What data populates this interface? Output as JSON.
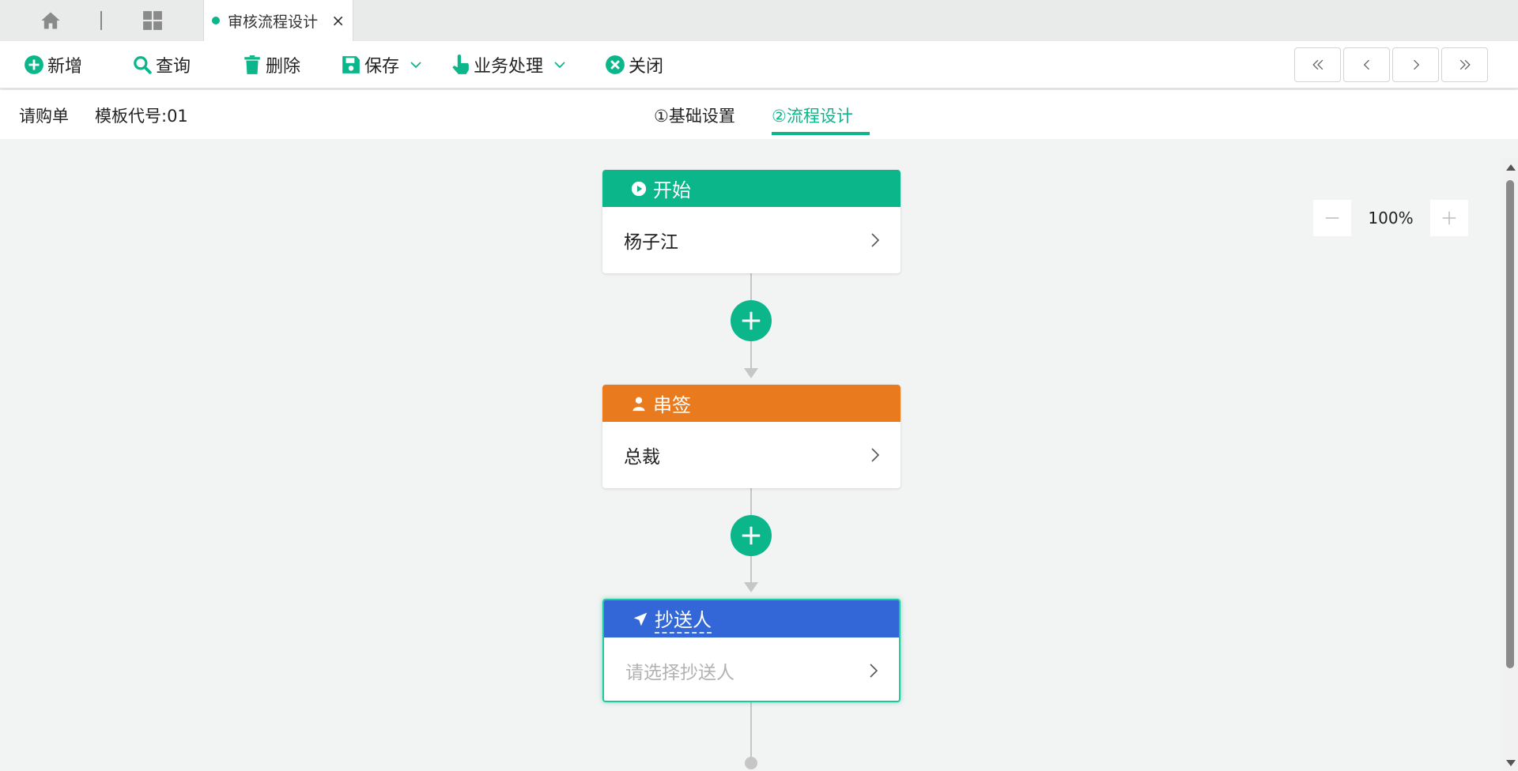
{
  "tabbar": {
    "home_icon": "home-icon",
    "apps_icon": "grid-icon",
    "active_tab": {
      "label": "审核流程设计",
      "close": "×"
    }
  },
  "toolbar": {
    "add": "新增",
    "query": "查询",
    "delete": "删除",
    "save": "保存",
    "business": "业务处理",
    "close": "关闭"
  },
  "pager": [
    "first-page-icon",
    "prev-page-icon",
    "next-page-icon",
    "last-page-icon"
  ],
  "info": {
    "doc_type": "请购单",
    "template": "模板代号:01"
  },
  "steps": {
    "step1": "①基础设置",
    "step2": "②流程设计"
  },
  "zoom": {
    "value": "100%"
  },
  "flow": {
    "start": {
      "title": "开始",
      "body": "杨子江",
      "color": "#0ab68a"
    },
    "approve": {
      "title": "串签",
      "body": "总裁",
      "color": "#e97a1d"
    },
    "cc": {
      "title": "抄送人",
      "placeholder": "请选择抄送人",
      "color": "#3366d6"
    }
  },
  "colors": {
    "accent": "#0ab68a"
  }
}
